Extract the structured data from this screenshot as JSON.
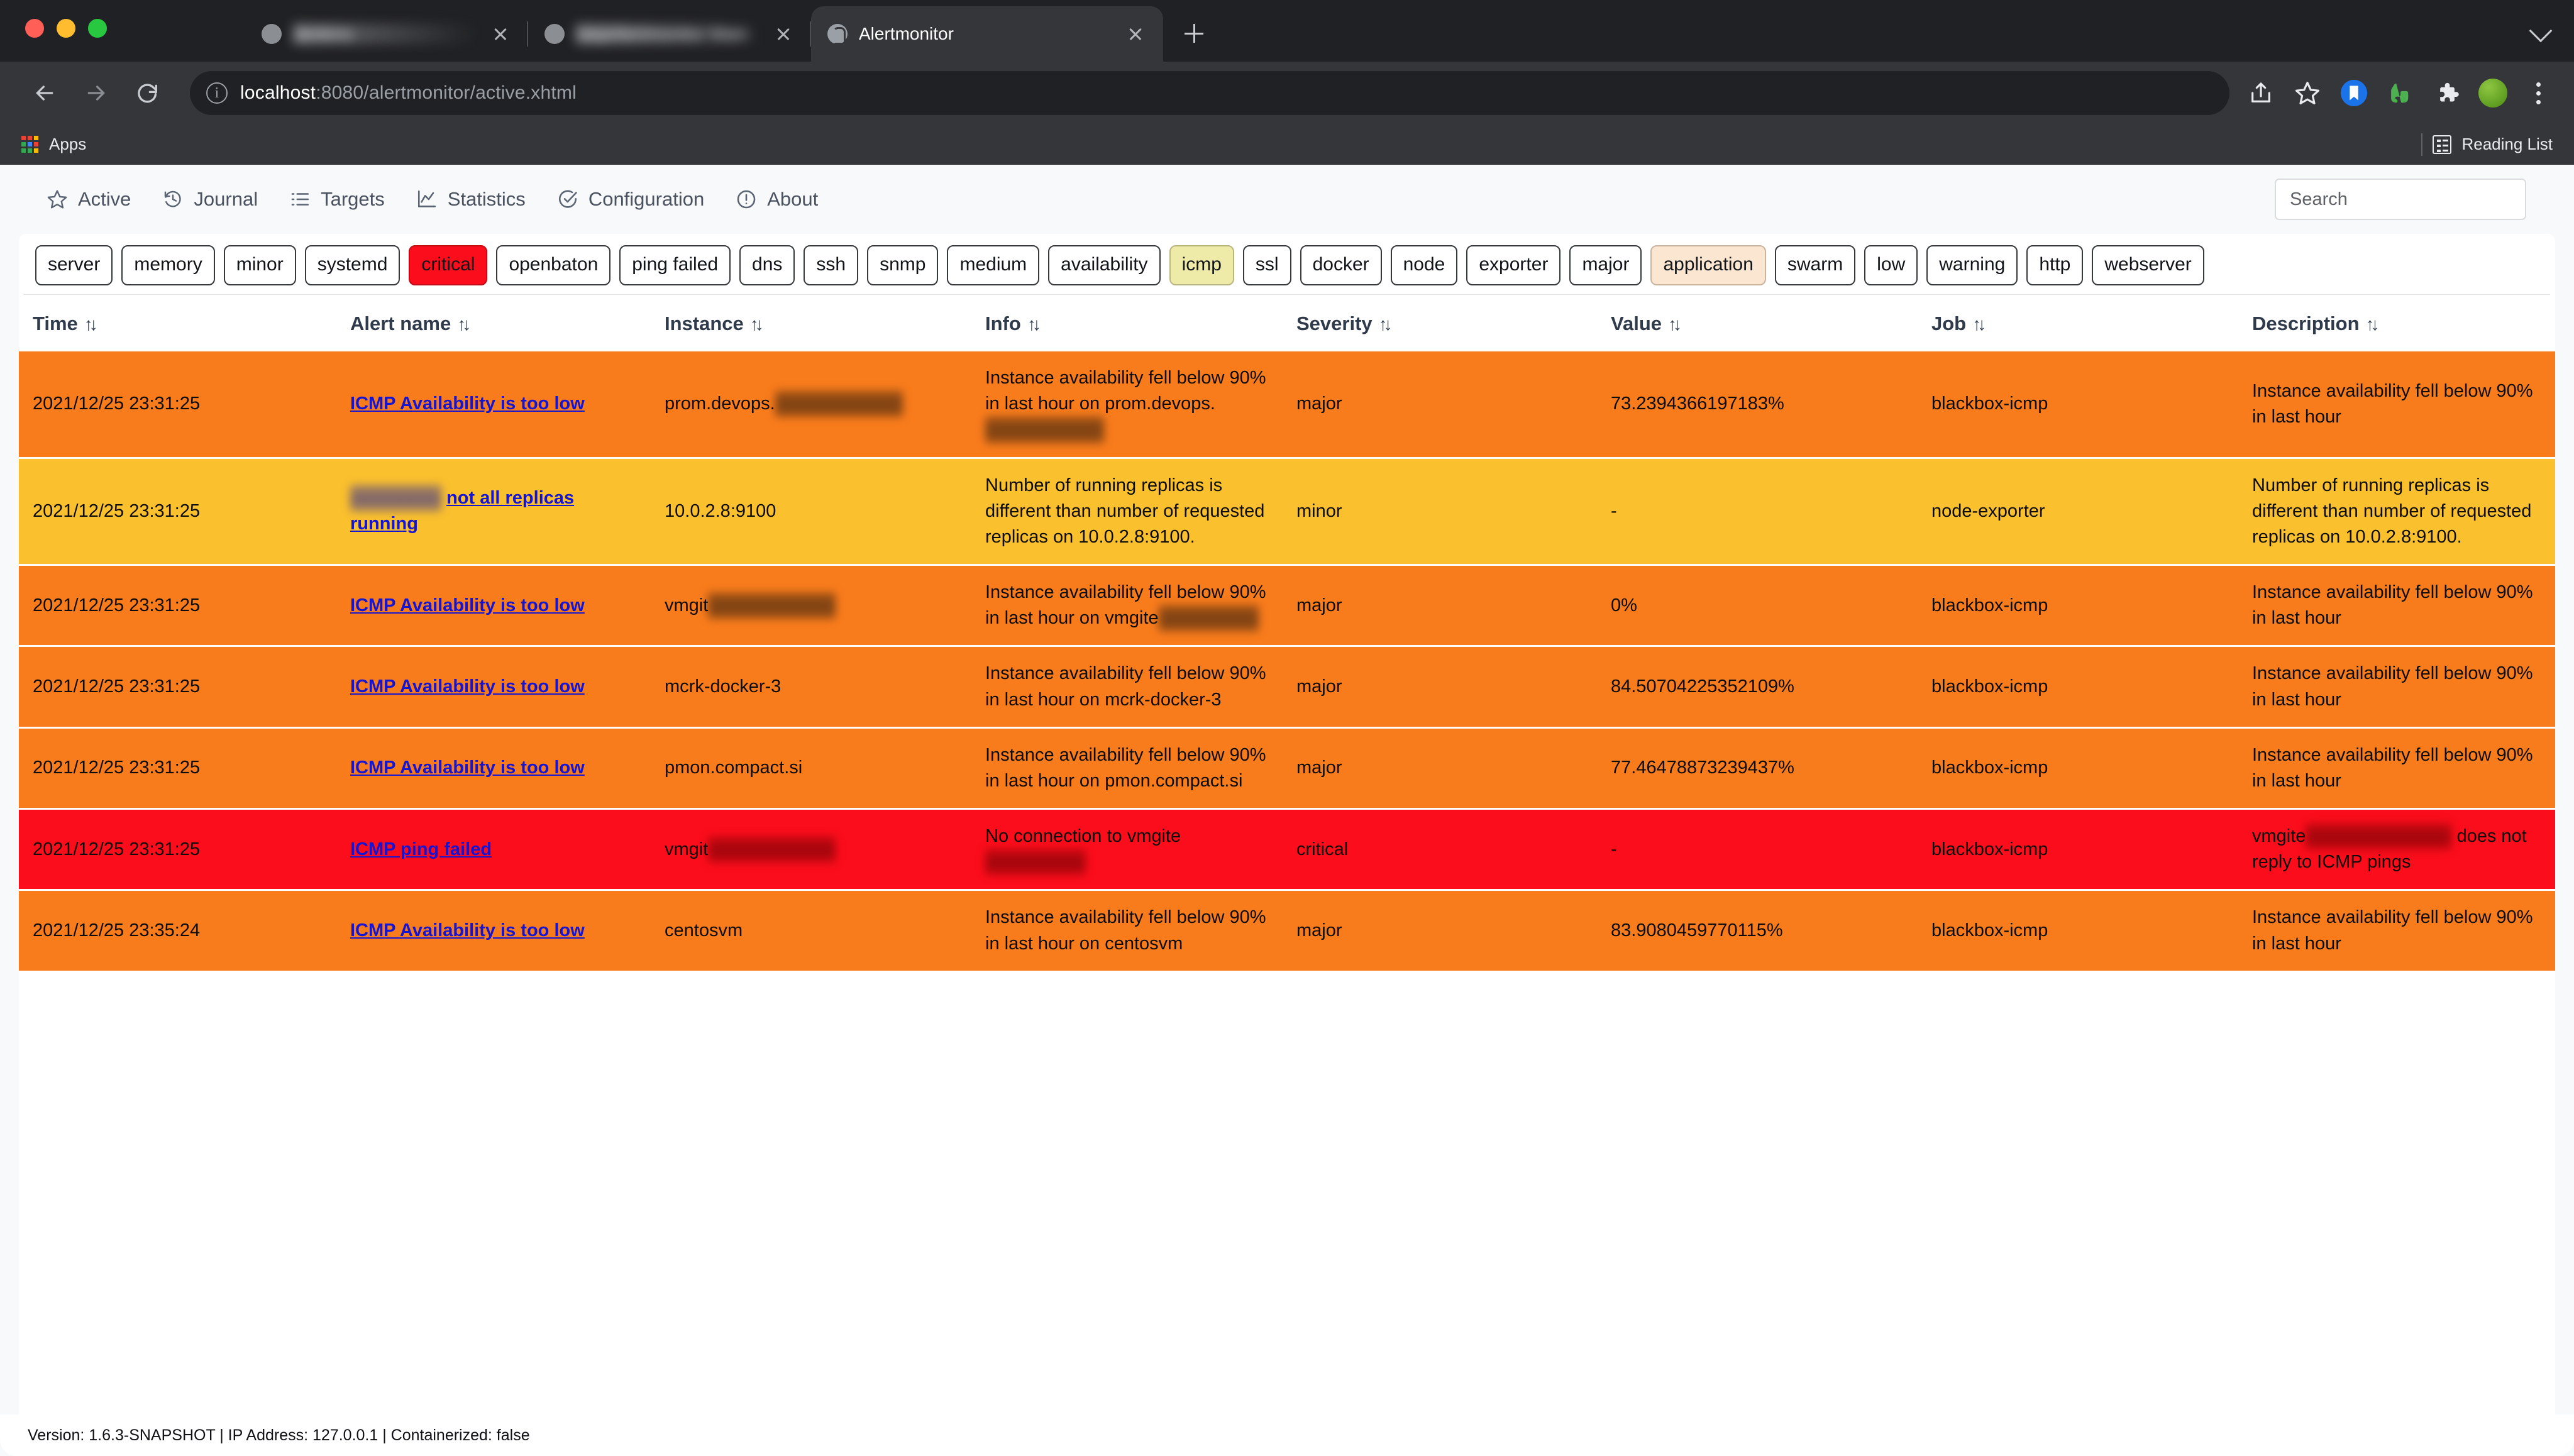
{
  "browser": {
    "tabs": [
      {
        "title": "Jenkins",
        "blurred": true,
        "active": false,
        "favicon": "generic-favicon"
      },
      {
        "title": "raspAlertmonitor Main",
        "blurred": true,
        "active": false,
        "favicon": "generic-favicon"
      },
      {
        "title": "Alertmonitor",
        "blurred": false,
        "active": true,
        "favicon": "alertmonitor-favicon"
      }
    ],
    "url_host": "localhost",
    "url_rest": ":8080/alertmonitor/active.xhtml",
    "bookmarks_label": "Apps",
    "reading_list_label": "Reading List",
    "toolbar_icons": [
      "share-icon",
      "star-icon",
      "bookmark-icon",
      "evernote-icon",
      "extensions-puzzle-icon",
      "profile-avatar",
      "chrome-menu-icon"
    ],
    "nav_icons": [
      "back-icon",
      "forward-icon",
      "reload-icon"
    ]
  },
  "app": {
    "nav": [
      {
        "label": "Active",
        "icon": "star-icon"
      },
      {
        "label": "Journal",
        "icon": "history-icon"
      },
      {
        "label": "Targets",
        "icon": "list-icon"
      },
      {
        "label": "Statistics",
        "icon": "chart-icon"
      },
      {
        "label": "Configuration",
        "icon": "check-circle-icon"
      },
      {
        "label": "About",
        "icon": "info-circle-icon"
      }
    ],
    "search": {
      "placeholder": "Search",
      "value": ""
    },
    "tags": [
      {
        "label": "server",
        "state": "default"
      },
      {
        "label": "memory",
        "state": "default"
      },
      {
        "label": "minor",
        "state": "default"
      },
      {
        "label": "systemd",
        "state": "default"
      },
      {
        "label": "critical",
        "state": "critical"
      },
      {
        "label": "openbaton",
        "state": "default"
      },
      {
        "label": "ping failed",
        "state": "default"
      },
      {
        "label": "dns",
        "state": "default"
      },
      {
        "label": "ssh",
        "state": "default"
      },
      {
        "label": "snmp",
        "state": "default"
      },
      {
        "label": "medium",
        "state": "default"
      },
      {
        "label": "availability",
        "state": "default"
      },
      {
        "label": "icmp",
        "state": "icmp"
      },
      {
        "label": "ssl",
        "state": "default"
      },
      {
        "label": "docker",
        "state": "default"
      },
      {
        "label": "node",
        "state": "default"
      },
      {
        "label": "exporter",
        "state": "default"
      },
      {
        "label": "major",
        "state": "default"
      },
      {
        "label": "application",
        "state": "application"
      },
      {
        "label": "swarm",
        "state": "default"
      },
      {
        "label": "low",
        "state": "default"
      },
      {
        "label": "warning",
        "state": "default"
      },
      {
        "label": "http",
        "state": "default"
      },
      {
        "label": "webserver",
        "state": "default"
      }
    ],
    "table": {
      "headers": [
        "Time",
        "Alert name",
        "Instance",
        "Info",
        "Severity",
        "Value",
        "Job",
        "Description"
      ],
      "sort_glyph": "↑↓",
      "rows": [
        {
          "time": "2021/12/25 23:31:25",
          "alert_name": "ICMP Availability is too low",
          "alert_prefix_redacted": "",
          "instance_visible": "prom.devops.",
          "instance_redacted": "xxxxxxxxxxxxxx",
          "info_pre": "Instance availability fell below 90% in last hour on prom.devops.",
          "info_redacted": "xxxxxxxxxxxxx",
          "info_post": "",
          "severity": "major",
          "value": "73.2394366197183%",
          "job": "blackbox-icmp",
          "desc_pre": "Instance availability fell below 90% in last hour",
          "desc_redacted": "",
          "desc_post": "",
          "sev_class": "sev-major"
        },
        {
          "time": "2021/12/25 23:31:25",
          "alert_name": "not all replicas running",
          "alert_prefix_redacted": "xxxxxxxxxx",
          "instance_visible": "10.0.2.8:9100",
          "instance_redacted": "",
          "info_pre": "Number of running replicas is different than number of requested replicas on 10.0.2.8:9100.",
          "info_redacted": "",
          "info_post": "",
          "severity": "minor",
          "value": "-",
          "job": "node-exporter",
          "desc_pre": "Number of running replicas is different than number of requested replicas on 10.0.2.8:9100.",
          "desc_redacted": "",
          "desc_post": "",
          "sev_class": "sev-minor"
        },
        {
          "time": "2021/12/25 23:31:25",
          "alert_name": "ICMP Availability is too low",
          "alert_prefix_redacted": "",
          "instance_visible": "vmgit",
          "instance_redacted": "xxxxxxxxxxxxxx",
          "info_pre": "Instance availability fell below 90% in last hour on vmgite",
          "info_redacted": "xxxxxxxxxxx",
          "info_post": "",
          "severity": "major",
          "value": "0%",
          "job": "blackbox-icmp",
          "desc_pre": "Instance availability fell below 90% in last hour",
          "desc_redacted": "",
          "desc_post": "",
          "sev_class": "sev-major"
        },
        {
          "time": "2021/12/25 23:31:25",
          "alert_name": "ICMP Availability is too low",
          "alert_prefix_redacted": "",
          "instance_visible": "mcrk-docker-3",
          "instance_redacted": "",
          "info_pre": "Instance availability fell below 90% in last hour on mcrk-docker-3",
          "info_redacted": "",
          "info_post": "",
          "severity": "major",
          "value": "84.50704225352109%",
          "job": "blackbox-icmp",
          "desc_pre": "Instance availability fell below 90% in last hour",
          "desc_redacted": "",
          "desc_post": "",
          "sev_class": "sev-major"
        },
        {
          "time": "2021/12/25 23:31:25",
          "alert_name": "ICMP Availability is too low",
          "alert_prefix_redacted": "",
          "instance_visible": "pmon.compact.si",
          "instance_redacted": "",
          "info_pre": "Instance availability fell below 90% in last hour on pmon.compact.si",
          "info_redacted": "",
          "info_post": "",
          "severity": "major",
          "value": "77.46478873239437%",
          "job": "blackbox-icmp",
          "desc_pre": "Instance availability fell below 90% in last hour",
          "desc_redacted": "",
          "desc_post": "",
          "sev_class": "sev-major"
        },
        {
          "time": "2021/12/25 23:31:25",
          "alert_name": "ICMP ping failed",
          "alert_prefix_redacted": "",
          "instance_visible": "vmgit",
          "instance_redacted": "xxxxxxxxxxxxxx",
          "info_pre": "No connection to vmgite",
          "info_redacted": "xxxxxxxxxxx",
          "info_post": "",
          "severity": "critical",
          "value": "-",
          "job": "blackbox-icmp",
          "desc_pre": "vmgite",
          "desc_redacted": "xxxxxxxxxxxxxxxx",
          "desc_post": " does not reply to ICMP pings",
          "sev_class": "sev-critical"
        },
        {
          "time": "2021/12/25 23:35:24",
          "alert_name": "ICMP Availability is too low",
          "alert_prefix_redacted": "",
          "instance_visible": "centosvm",
          "instance_redacted": "",
          "info_pre": "Instance availability fell below 90% in last hour on centosvm",
          "info_redacted": "",
          "info_post": "",
          "severity": "major",
          "value": "83.9080459770115%",
          "job": "blackbox-icmp",
          "desc_pre": "Instance availability fell below 90% in last hour",
          "desc_redacted": "",
          "desc_post": "",
          "sev_class": "sev-major"
        }
      ]
    },
    "footer": "Version: 1.6.3-SNAPSHOT | IP Address: 127.0.0.1 | Containerized: false"
  },
  "colors": {
    "severity_major": "#f97c1c",
    "severity_minor": "#fbc02d",
    "severity_critical": "#fc0d1b",
    "tag_critical": "#fc0d1b",
    "tag_icmp": "#eeeaa8",
    "tag_application": "#fbe6d2",
    "link": "#1414d4",
    "chrome_bg": "#35363a"
  }
}
